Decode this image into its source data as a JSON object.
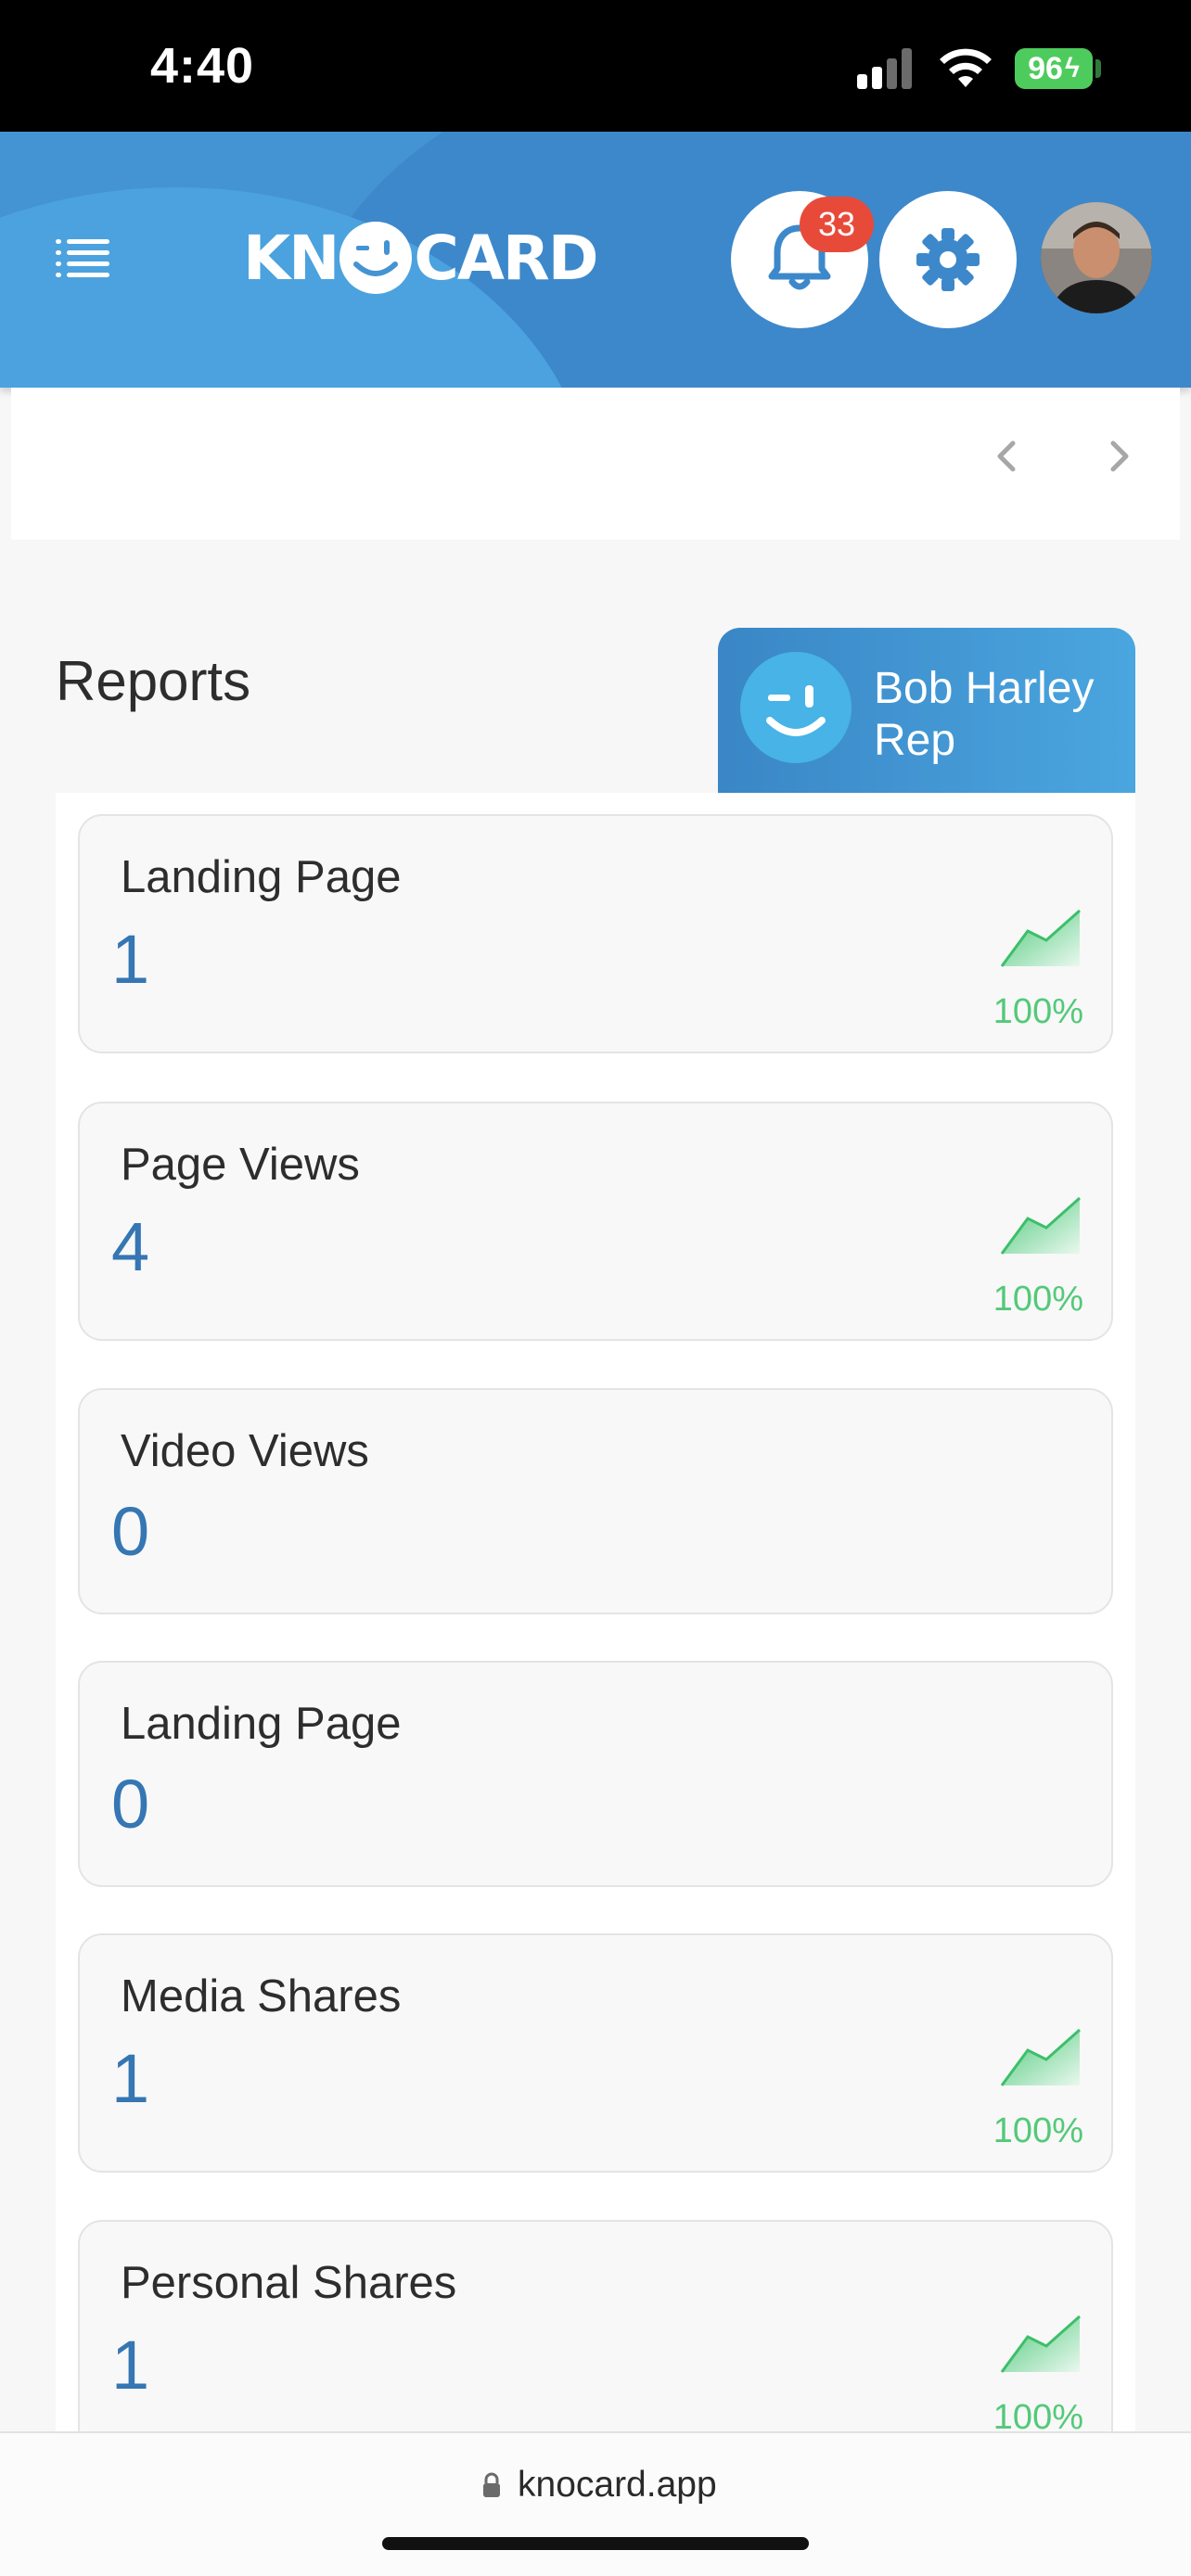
{
  "status_bar": {
    "time": "4:40",
    "battery": "96"
  },
  "header": {
    "logo_text_left": "KN",
    "logo_text_right": "CARD",
    "notification_count": "33",
    "accent_color": "#4493d3"
  },
  "reports": {
    "title": "Reports",
    "rep_name": "Bob Harley Rep",
    "cards": [
      {
        "label": "Landing Page",
        "value": "1",
        "trend": "up",
        "percent": "100%"
      },
      {
        "label": "Page Views",
        "value": "4",
        "trend": "up",
        "percent": "100%"
      },
      {
        "label": "Video Views",
        "value": "0",
        "trend": "none",
        "percent": ""
      },
      {
        "label": "Landing Page",
        "value": "0",
        "trend": "none",
        "percent": ""
      },
      {
        "label": "Media Shares",
        "value": "1",
        "trend": "up",
        "percent": "100%"
      },
      {
        "label": "Personal Shares",
        "value": "1",
        "trend": "up",
        "percent": "100%"
      }
    ]
  },
  "browser": {
    "url": "knocard.app"
  },
  "icons": [
    "menu-icon",
    "bell-icon",
    "gear-icon",
    "chevron-left-icon",
    "chevron-right-icon",
    "lock-icon",
    "trend-up-icon"
  ]
}
